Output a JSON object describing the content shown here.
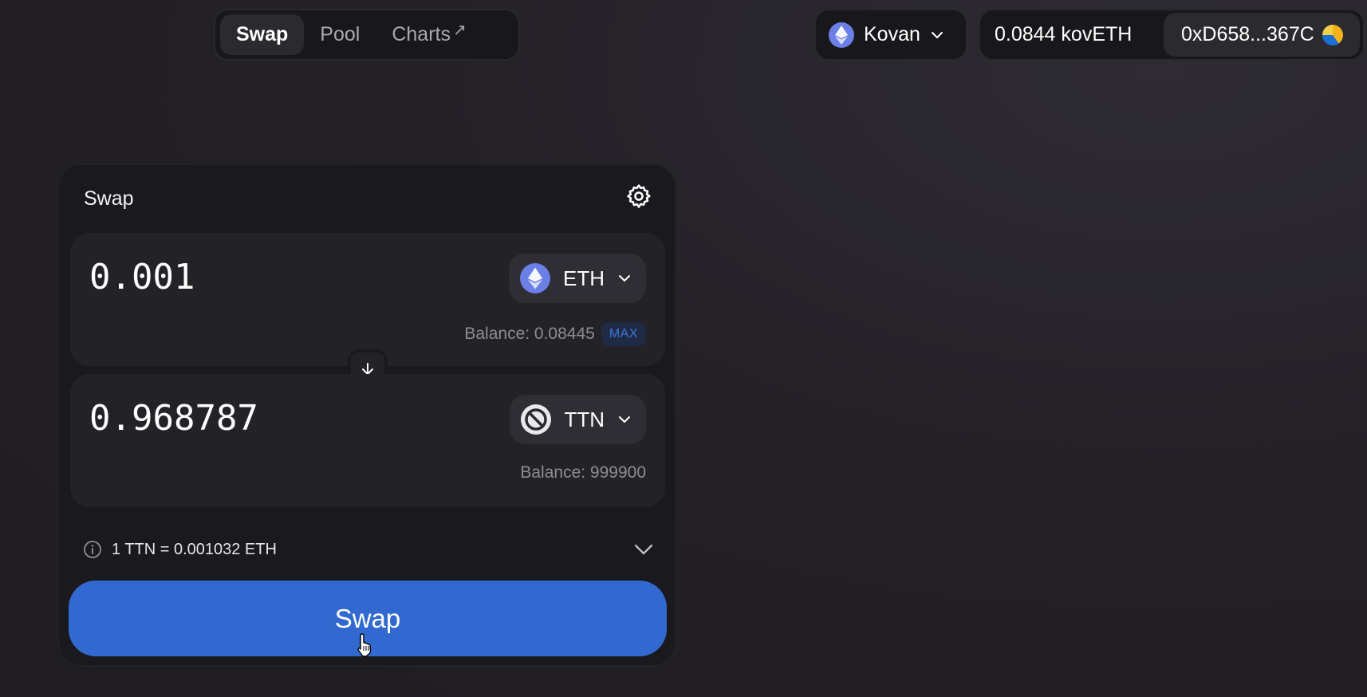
{
  "nav": {
    "tabs": [
      {
        "label": "Swap",
        "active": true
      },
      {
        "label": "Pool",
        "active": false
      },
      {
        "label": "Charts",
        "active": false,
        "external_icon": "↗"
      }
    ]
  },
  "network": {
    "label": "Kovan",
    "icon": "ethereum-icon"
  },
  "account": {
    "balance": "0.0844 kovETH",
    "address": "0xD658...367C",
    "avatar_icon": "jazzicon"
  },
  "swap_card": {
    "title": "Swap",
    "settings_icon": "gear-icon",
    "from": {
      "amount": "0.001",
      "token": "ETH",
      "token_icon": "ethereum-icon",
      "balance": "Balance: 0.08445",
      "max_label": "MAX"
    },
    "switch_icon": "arrow-down-icon",
    "to": {
      "amount": "0.968787",
      "token": "TTN",
      "token_icon": "unknown-token-icon",
      "balance": "Balance: 999900"
    },
    "rate": "1 TTN = 0.001032 ETH",
    "action_label": "Swap"
  },
  "colors": {
    "accent": "#3169d0",
    "background": "#242127",
    "card": "#1a191d",
    "field": "#232227",
    "eth_icon": "#6c7fe6"
  }
}
